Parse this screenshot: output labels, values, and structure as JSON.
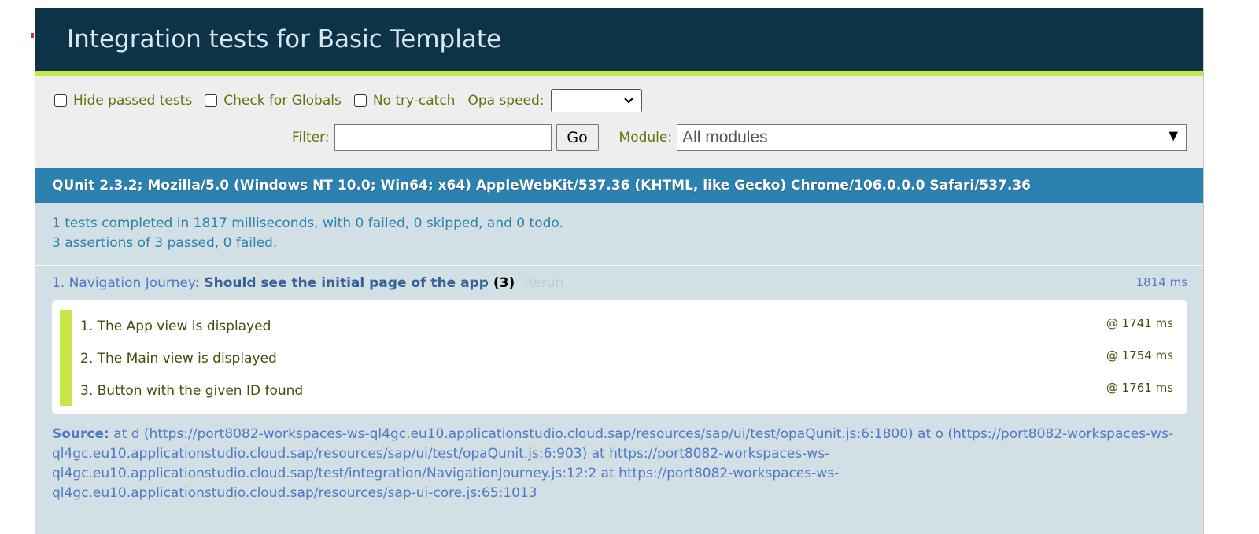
{
  "header": {
    "title": "Integration tests for Basic Template"
  },
  "toolbar": {
    "hide_passed": "Hide passed tests",
    "check_globals": "Check for Globals",
    "no_try_catch": "No try-catch",
    "opa_speed_label": "Opa speed:",
    "opa_speed_value": "",
    "filter_label": "Filter:",
    "filter_value": "",
    "go_label": "Go",
    "module_label": "Module:",
    "module_value": "All modules"
  },
  "user_agent": "QUnit 2.3.2; Mozilla/5.0 (Windows NT 10.0; Win64; x64) AppleWebKit/537.36 (KHTML, like Gecko) Chrome/106.0.0.0 Safari/537.36",
  "result": {
    "line1": "1 tests completed in 1817 milliseconds, with 0 failed, 0 skipped, and 0 todo.",
    "line2": "3 assertions of 3 passed, 0 failed."
  },
  "test": {
    "module": "1. Navigation Journey:",
    "name": "Should see the initial page of the app",
    "counts": "(3)",
    "rerun": "Rerun",
    "runtime": "1814 ms",
    "assertions": [
      {
        "label": "1. The App view is displayed",
        "time": "@ 1741 ms"
      },
      {
        "label": "2. The Main view is displayed",
        "time": "@ 1754 ms"
      },
      {
        "label": "3. Button with the given ID found",
        "time": "@ 1761 ms"
      }
    ],
    "source_label": "Source:",
    "source_text": "at d (https://port8082-workspaces-ws-ql4gc.eu10.applicationstudio.cloud.sap/resources/sap/ui/test/opaQunit.js:6:1800) at o (https://port8082-workspaces-ws-ql4gc.eu10.applicationstudio.cloud.sap/resources/sap/ui/test/opaQunit.js:6:903) at https://port8082-workspaces-ws-ql4gc.eu10.applicationstudio.cloud.sap/test/integration/NavigationJourney.js:12:2 at https://port8082-workspaces-ws-ql4gc.eu10.applicationstudio.cloud.sap/resources/sap-ui-core.js:65:1013"
  },
  "colors": {
    "header_bg": "#0d3349",
    "accent_green": "#c6e746",
    "banner_blue": "#2b81af",
    "result_bg": "#d2e0e6"
  }
}
